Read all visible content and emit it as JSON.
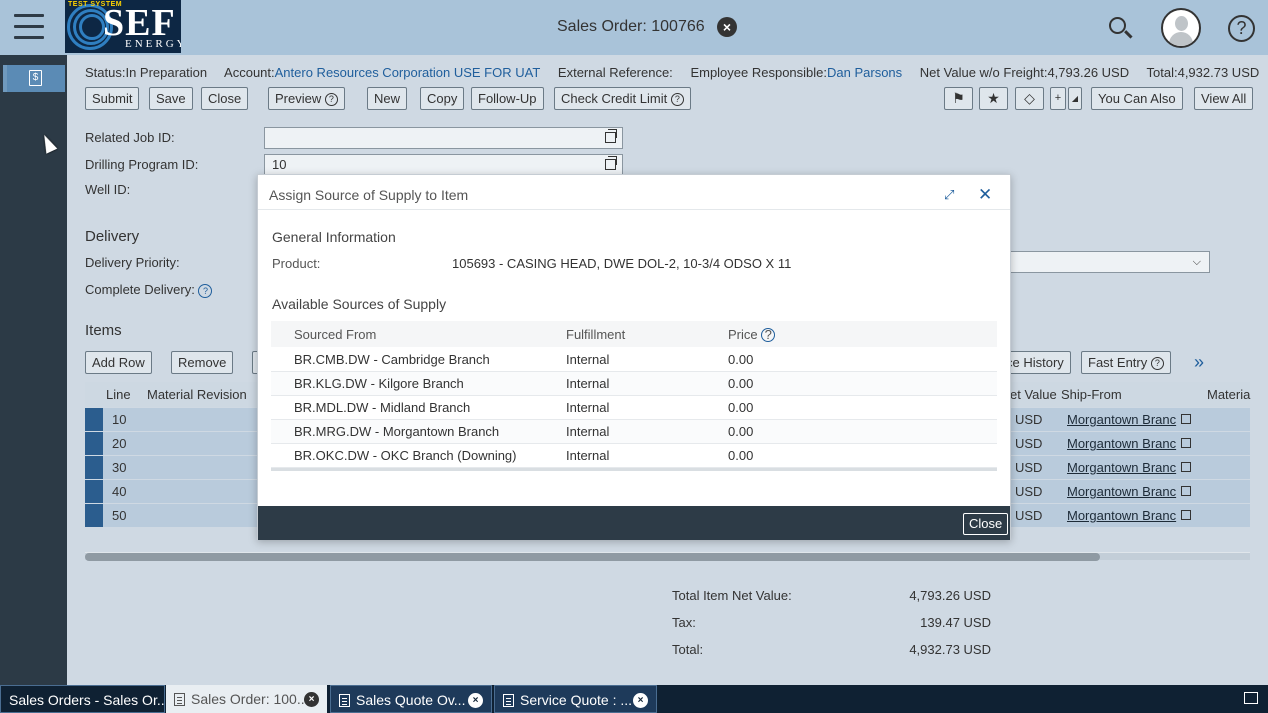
{
  "header": {
    "title": "Sales Order: 100766",
    "logo": {
      "badge": "TEST SYSTEM",
      "name": "SEF",
      "sub": "ENERGY"
    }
  },
  "status": {
    "status_label": "Status:",
    "status_value": "In Preparation",
    "account_label": "Account:",
    "account_value": "Antero Resources Corporation USE FOR UAT",
    "extref_label": "External Reference:",
    "employee_label": "Employee Responsible:",
    "employee_value": "Dan Parsons",
    "netvalue_label": "Net Value w/o Freight:",
    "netvalue_value": "4,793.26 USD",
    "total_label": "Total:",
    "total_value": "4,932.73 USD"
  },
  "toolbar": {
    "submit": "Submit",
    "save": "Save",
    "close": "Close",
    "preview": "Preview",
    "new": "New",
    "copy": "Copy",
    "followup": "Follow-Up",
    "credit": "Check Credit Limit",
    "youcanalso": "You Can Also",
    "viewall": "View All"
  },
  "form": {
    "related_job_label": "Related Job ID:",
    "related_job_value": "",
    "drilling_label": "Drilling Program ID:",
    "drilling_value": "10",
    "well_label": "Well ID:",
    "delivery_title": "Delivery",
    "delivery_priority_label": "Delivery Priority:",
    "complete_delivery_label": "Complete Delivery:"
  },
  "items": {
    "title": "Items",
    "add_row": "Add Row",
    "remove": "Remove",
    "price_history": "ce History",
    "fast_entry": "Fast Entry",
    "columns": {
      "line": "Line",
      "material_revision": "Material Revision",
      "net_value": "et Value",
      "ship_from": "Ship-From",
      "material": "Materia"
    },
    "rows": [
      {
        "line": "10",
        "usd": "USD",
        "ship": "Morgantown Branc"
      },
      {
        "line": "20",
        "usd": "USD",
        "ship": "Morgantown Branc"
      },
      {
        "line": "30",
        "usd": "USD",
        "ship": "Morgantown Branc"
      },
      {
        "line": "40",
        "usd": "USD",
        "ship": "Morgantown Branc"
      },
      {
        "line": "50",
        "usd": "USD",
        "ship": "Morgantown Branc"
      }
    ]
  },
  "totals": {
    "net_label": "Total Item Net Value:",
    "net_value": "4,793.26 USD",
    "tax_label": "Tax:",
    "tax_value": "139.47 USD",
    "total_label": "Total:",
    "total_value": "4,932.73 USD"
  },
  "modal": {
    "title": "Assign Source of Supply to Item",
    "general_title": "General Information",
    "product_label": "Product:",
    "product_value": "105693 - CASING HEAD, DWE DOL-2, 10-3/4 ODSO X 11",
    "sources_title": "Available Sources of Supply",
    "columns": {
      "sourced_from": "Sourced From",
      "fulfillment": "Fulfillment",
      "price": "Price"
    },
    "rows": [
      {
        "source": "BR.CMB.DW - Cambridge Branch",
        "fulfillment": "Internal",
        "price": "0.00"
      },
      {
        "source": "BR.KLG.DW - Kilgore Branch",
        "fulfillment": "Internal",
        "price": "0.00"
      },
      {
        "source": "BR.MDL.DW - Midland Branch",
        "fulfillment": "Internal",
        "price": "0.00"
      },
      {
        "source": "BR.MRG.DW - Morgantown Branch",
        "fulfillment": "Internal",
        "price": "0.00"
      },
      {
        "source": "BR.OKC.DW - OKC Branch (Downing)",
        "fulfillment": "Internal",
        "price": "0.00"
      }
    ],
    "close_label": "Close"
  },
  "taskbar": {
    "tasks": [
      {
        "label": "Sales Orders - Sales Or..."
      },
      {
        "label": "Sales Order: 100..."
      },
      {
        "label": "Sales Quote Ov..."
      },
      {
        "label": "Service Quote : ..."
      }
    ]
  }
}
